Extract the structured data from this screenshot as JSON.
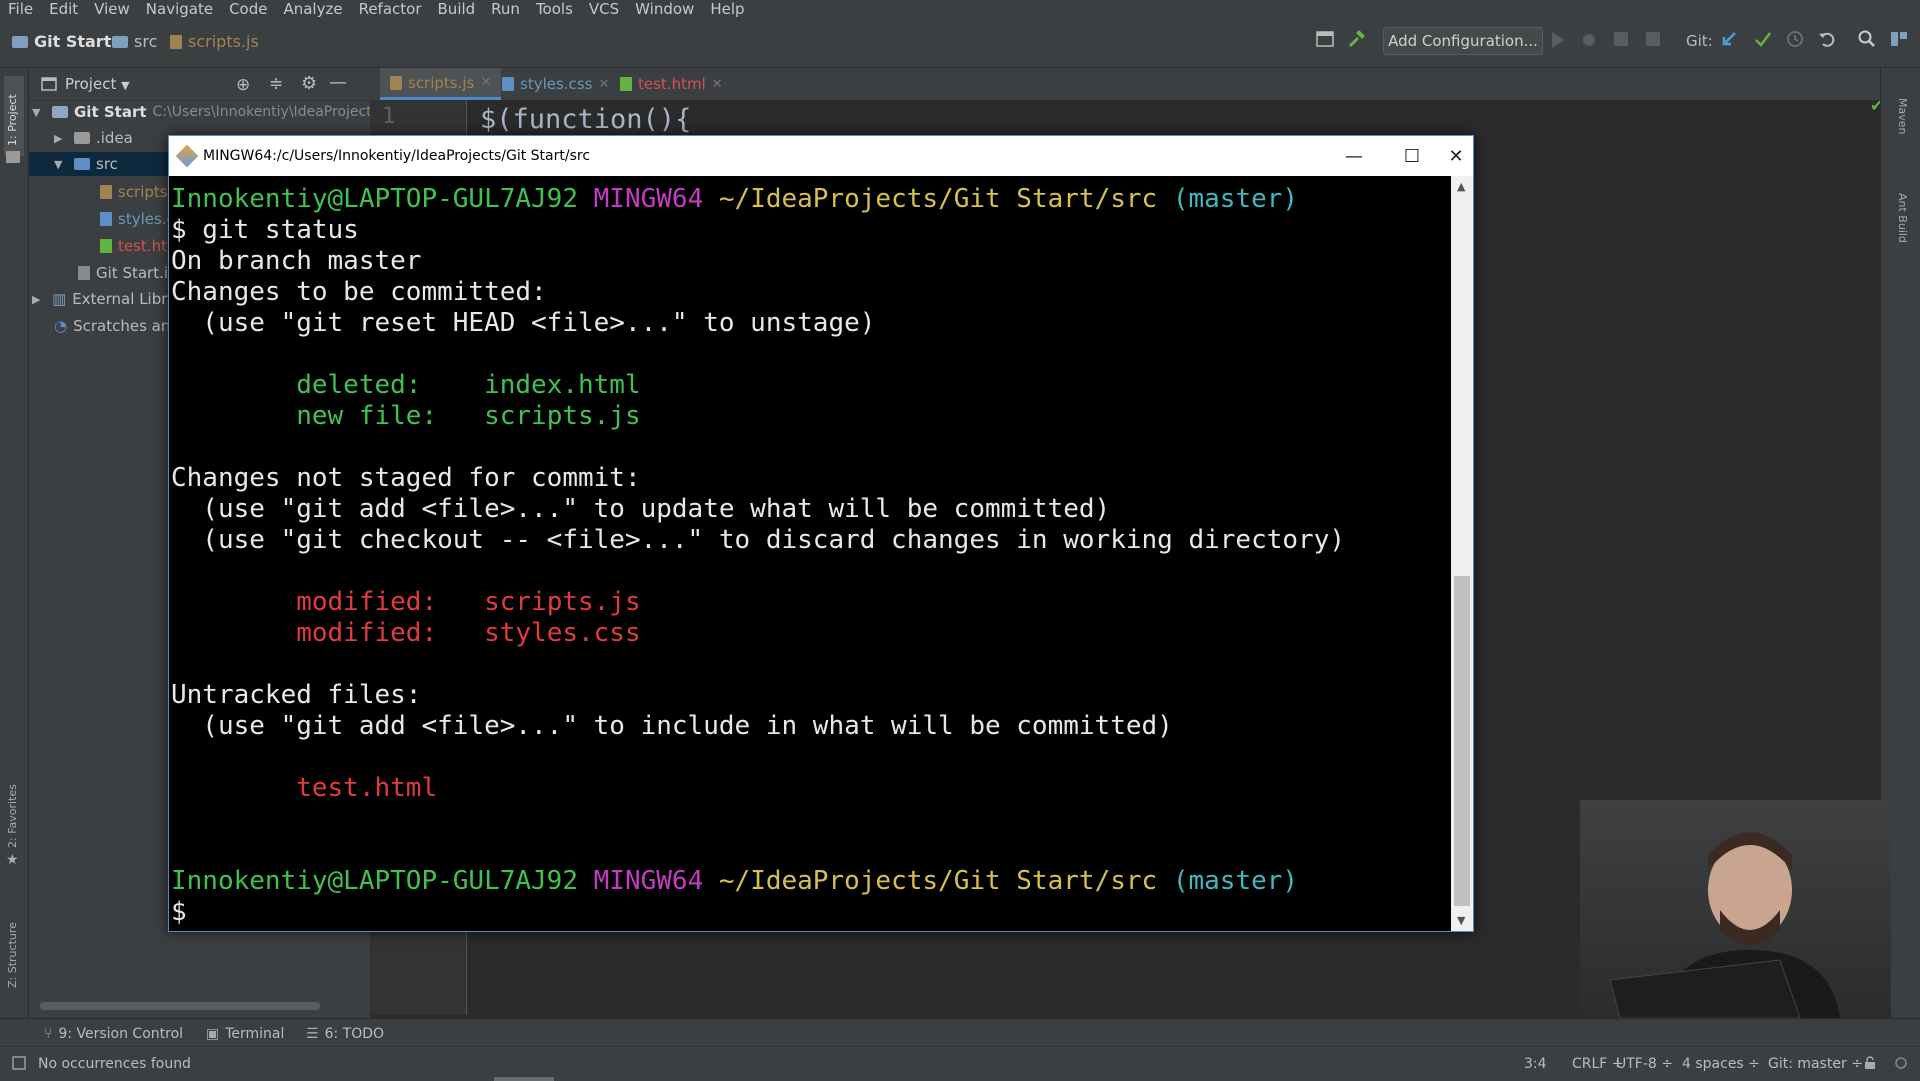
{
  "menu": [
    "File",
    "Edit",
    "View",
    "Navigate",
    "Code",
    "Analyze",
    "Refactor",
    "Build",
    "Run",
    "Tools",
    "VCS",
    "Window",
    "Help"
  ],
  "breadcrumb": {
    "project": "Git Start",
    "folder": "src",
    "file": "scripts.js"
  },
  "toolbar": {
    "add_configuration": "Add Configuration...",
    "git_label": "Git:"
  },
  "project_panel": {
    "title": "Project",
    "root": "Git Start",
    "root_path": "C:\\Users\\Innokentiy\\IdeaProjects\\G",
    "items": [
      {
        "label": ".idea"
      },
      {
        "label": "src"
      },
      {
        "label": "scripts"
      },
      {
        "label": "styles.c"
      },
      {
        "label": "test.htm"
      },
      {
        "label": "Git Start.in"
      },
      {
        "label": "External Libra"
      },
      {
        "label": "Scratches and"
      }
    ]
  },
  "left_strip": {
    "project": "1: Project",
    "favorites": "2: Favorites",
    "structure": "Z: Structure"
  },
  "right_strip": {
    "maven": "Maven",
    "ant": "Ant Build"
  },
  "tabs": [
    {
      "label": "scripts.js",
      "active": true
    },
    {
      "label": "styles.css",
      "active": false
    },
    {
      "label": "test.html",
      "active": false
    }
  ],
  "editor": {
    "line_number": "1",
    "code": "$(function(){"
  },
  "terminal": {
    "title": "MINGW64:/c/Users/Innokentiy/IdeaProjects/Git Start/src",
    "prompt_user": "Innokentiy@LAPTOP-GUL7AJ92",
    "prompt_sys": "MINGW64",
    "prompt_path": "~/IdeaProjects/Git Start/src",
    "prompt_branch": "(master)",
    "command": "$ git status",
    "on_branch": "On branch master",
    "staged_header": "Changes to be committed:",
    "staged_hint": "  (use \"git reset HEAD <file>...\" to unstage)",
    "staged": [
      {
        "status": "        deleted:    ",
        "file": "index.html"
      },
      {
        "status": "        new file:   ",
        "file": "scripts.js"
      }
    ],
    "unstaged_header": "Changes not staged for commit:",
    "unstaged_hint1": "  (use \"git add <file>...\" to update what will be committed)",
    "unstaged_hint2": "  (use \"git checkout -- <file>...\" to discard changes in working directory)",
    "unstaged": [
      {
        "status": "        modified:   ",
        "file": "scripts.js"
      },
      {
        "status": "        modified:   ",
        "file": "styles.css"
      }
    ],
    "untracked_header": "Untracked files:",
    "untracked_hint": "  (use \"git add <file>...\" to include in what will be committed)",
    "untracked": [
      "        test.html"
    ],
    "final_prompt": "$"
  },
  "bottom_tools": [
    {
      "label": "9: Version Control"
    },
    {
      "label": "Terminal"
    },
    {
      "label": "6: TODO"
    }
  ],
  "status": {
    "message": "No occurrences found",
    "position": "3:4",
    "line_sep": "CRLF ÷",
    "encoding": "UTF-8 ÷",
    "indent": "4 spaces ÷",
    "git": "Git: master ÷"
  },
  "colors": {
    "prompt_green": "#3fc24f",
    "prompt_magenta": "#c43bc3",
    "prompt_yellow": "#d6c24a",
    "prompt_cyan": "#3fb8c4",
    "staged_green": "#3fc24f",
    "unstaged_red": "#e03c3c"
  }
}
